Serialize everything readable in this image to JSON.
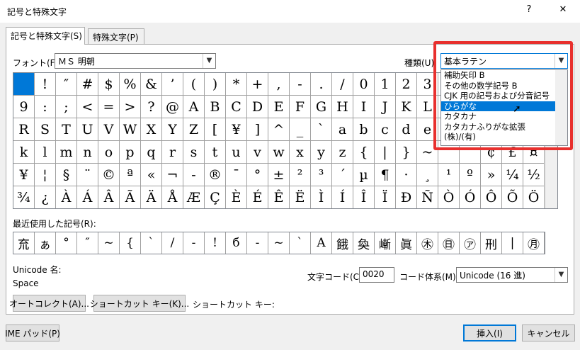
{
  "window": {
    "title": "記号と特殊文字",
    "help": "?",
    "close": "✕"
  },
  "tabs": [
    {
      "label": "記号と特殊文字(S)"
    },
    {
      "label": "特殊文字(P)"
    }
  ],
  "font": {
    "label": "フォント(F):",
    "value": "ＭＳ 明朝"
  },
  "subset": {
    "label": "種類(U):",
    "value": "基本ラテン",
    "options": [
      "補助矢印 B",
      "その他の数学記号 B",
      "CJK 用の記号および分音記号",
      "ひらがな",
      "カタカナ",
      "カタカナふりがな拡張",
      "(株)/(有)"
    ],
    "selected_index": 3
  },
  "grid_chars": [
    " ",
    "!",
    "″",
    "#",
    "$",
    "%",
    "&",
    "’",
    "(",
    ")",
    "*",
    "+",
    ",",
    "-",
    ".",
    "/",
    "0",
    "1",
    "2",
    "3",
    "",
    "",
    "",
    "",
    "",
    "9",
    ":",
    ";",
    "<",
    "=",
    ">",
    "?",
    "@",
    "A",
    "B",
    "C",
    "D",
    "E",
    "F",
    "G",
    "H",
    "I",
    "J",
    "K",
    "L",
    "",
    "",
    "",
    "",
    "",
    "R",
    "S",
    "T",
    "U",
    "V",
    "W",
    "X",
    "Y",
    "Z",
    "[",
    "¥",
    "]",
    "^",
    "_",
    "`",
    "a",
    "b",
    "c",
    "d",
    "e",
    "",
    "",
    "",
    "",
    "",
    "k",
    "l",
    "m",
    "n",
    "o",
    "p",
    "q",
    "r",
    "s",
    "t",
    "u",
    "v",
    "w",
    "x",
    "y",
    "z",
    "{",
    "|",
    "}",
    "~",
    "",
    "",
    "¢",
    "£",
    "¤",
    "¥",
    "¦",
    "§",
    "¨",
    "©",
    "ª",
    "«",
    "¬",
    "-",
    "®",
    "¯",
    "°",
    "±",
    "²",
    "³",
    "´",
    "µ",
    "¶",
    "·",
    "¸",
    "¹",
    "º",
    "»",
    "¼",
    "½",
    "¾",
    "¿",
    "À",
    "Á",
    "Â",
    "Ã",
    "Ä",
    "Å",
    "Æ",
    "Ç",
    "È",
    "É",
    "Ê",
    "Ë",
    "Ì",
    "Í",
    "Î",
    "Ï",
    "Ð",
    "Ñ",
    "Ò",
    "Ó",
    "Ô",
    "Õ",
    "Ö"
  ],
  "recent": {
    "label": "最近使用した記号(R):",
    "chars": [
      "㐬",
      "ぁ",
      "°",
      "″",
      "~",
      "{",
      "`",
      "/",
      "-",
      "!",
      "б",
      "-",
      "~",
      "`",
      "A",
      "餓",
      "奐",
      "嶃",
      "眞",
      "㊍",
      "㊐",
      "㋐",
      "刑",
      "|",
      "㊊"
    ]
  },
  "unicode": {
    "name_label": "Unicode 名:",
    "name_value": "Space"
  },
  "char_code": {
    "label": "文字コード(C):",
    "value": "0020"
  },
  "code_system": {
    "label": "コード体系(M):",
    "value": "Unicode (16 進)"
  },
  "buttons": {
    "autocorrect": "オートコレクト(A)...",
    "shortcut_key": "ショートカット キー(K)...",
    "shortcut_label": "ショートカット キー:",
    "ime_pad": "IME パッド(P)",
    "insert": "挿入(I)",
    "cancel": "キャンセル"
  },
  "colors": {
    "accent": "#0078d7",
    "highlight": "#e8302e"
  }
}
